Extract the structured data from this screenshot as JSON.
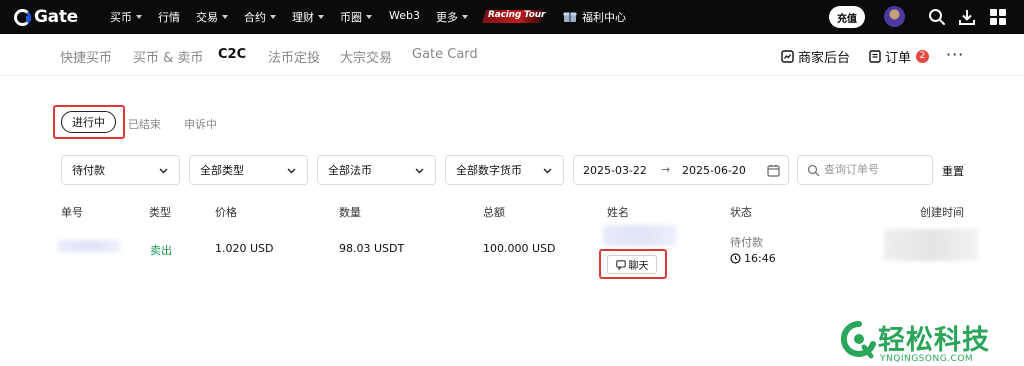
{
  "topnav": {
    "logo_text": "Gate",
    "items": [
      {
        "label": "买币",
        "caret": true
      },
      {
        "label": "行情",
        "caret": false
      },
      {
        "label": "交易",
        "caret": true
      },
      {
        "label": "合约",
        "caret": true
      },
      {
        "label": "理财",
        "caret": true
      },
      {
        "label": "币圈",
        "caret": true
      },
      {
        "label": "Web3",
        "caret": false
      },
      {
        "label": "更多",
        "caret": true
      }
    ],
    "racing_label": "Racing Tour",
    "welfare_label": "福利中心",
    "charge_label": "充值",
    "icons": [
      "gift-icon",
      "search-icon",
      "download-icon",
      "grid-icon"
    ]
  },
  "subnav": {
    "items": [
      "快捷买币",
      "买币 & 卖币",
      "C2C",
      "法币定投",
      "大宗交易",
      "Gate Card"
    ],
    "active": "C2C",
    "merchant_label": "商家后台",
    "orders_label": "订单",
    "orders_badge": "2"
  },
  "tabs": {
    "active": "进行中",
    "ended": "已结束",
    "appeal": "申诉中"
  },
  "filters": {
    "payment_status": "待付款",
    "type": "全部类型",
    "fiat": "全部法币",
    "crypto": "全部数字货币",
    "date_from": "2025-03-22",
    "date_to": "2025-06-20",
    "search_placeholder": "查询订单号",
    "reset_label": "重置"
  },
  "table": {
    "headers": [
      "单号",
      "类型",
      "价格",
      "数量",
      "总额",
      "姓名",
      "状态",
      "创建时间"
    ],
    "rows": [
      {
        "type": "卖出",
        "price": "1.020 USD",
        "quantity": "98.03 USDT",
        "total": "100.000 USD",
        "chat_label": "聊天",
        "status": "待付款",
        "countdown": "16:46"
      }
    ]
  },
  "watermark": {
    "cn": "轻松科技",
    "en": "YNQINGSONG.COM"
  },
  "colors": {
    "nav_bg": "#0b0b0b",
    "sell_green": "#1c9a55",
    "badge_red": "#e5483f",
    "highlight_red": "#d93b3b",
    "watermark_green": "#2aa55a"
  }
}
